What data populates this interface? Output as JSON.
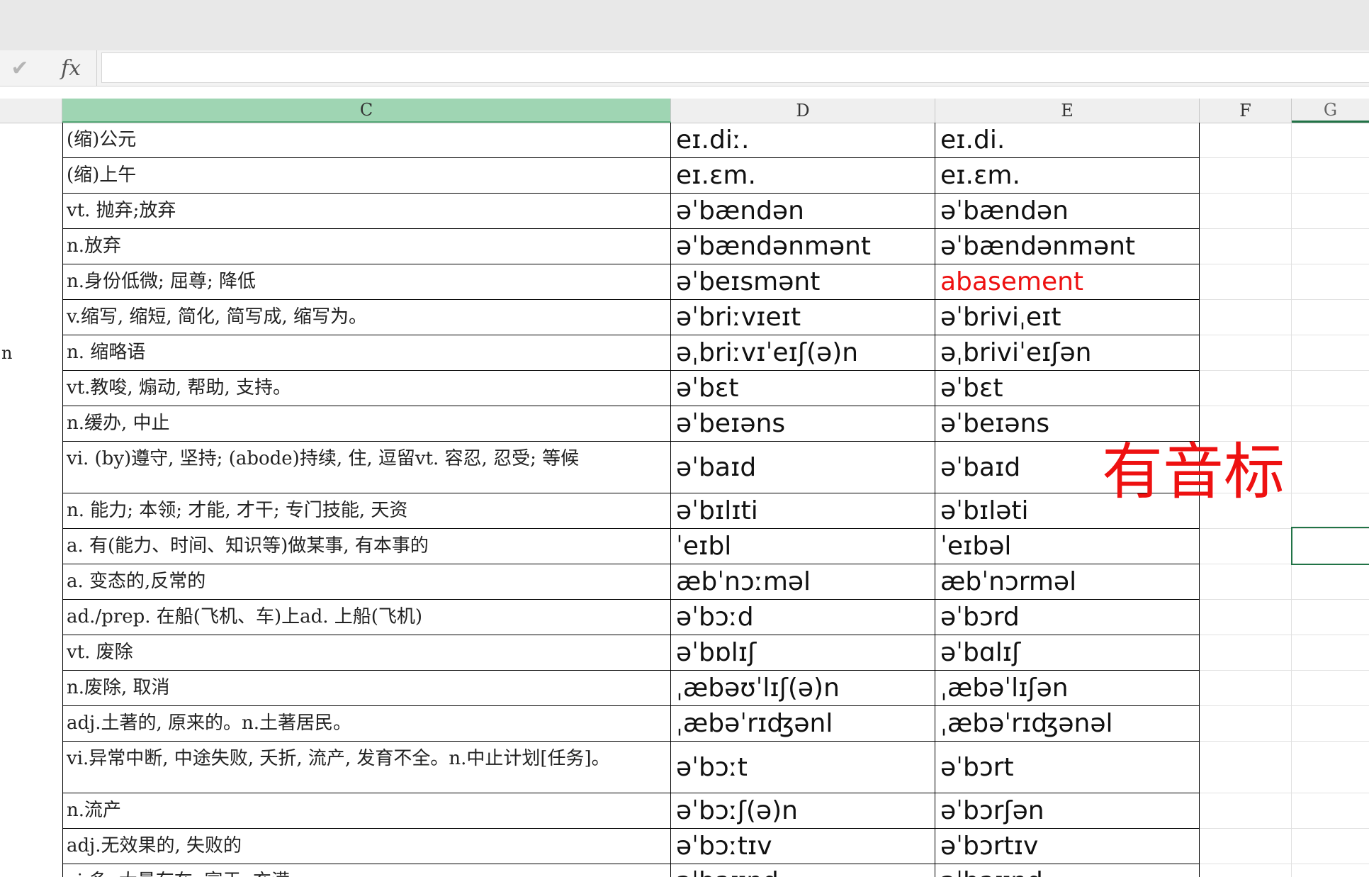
{
  "formula_bar": {
    "check_icon": "check-icon",
    "fx_label": "fx",
    "value": ""
  },
  "columns": {
    "C": "C",
    "D": "D",
    "E": "E",
    "F": "F",
    "G": "G"
  },
  "rows": [
    {
      "b": "",
      "c": "(缩)公元",
      "d": "eɪ.diː.",
      "e": "eɪ.di."
    },
    {
      "b": "",
      "c": "(缩)上午",
      "d": "eɪ.ɛm.",
      "e": "eɪ.ɛm."
    },
    {
      "b": "",
      "c": "vt. 抛弃;放弃",
      "d": "əˈbændən",
      "e": "əˈbændən"
    },
    {
      "b": "",
      "c": "n.放弃",
      "d": "əˈbændənmənt",
      "e": "əˈbændənmənt"
    },
    {
      "b": "",
      "c": "n.身份低微; 屈尊; 降低",
      "d": "əˈbeɪsmənt",
      "e": "abasement",
      "e_red": true
    },
    {
      "b": "",
      "c": "v.缩写, 缩短, 简化, 简写成, 缩写为。",
      "d": "əˈbriːvɪeɪt",
      "e": "əˈbriviˌeɪt"
    },
    {
      "b": "n",
      "c": "n. 缩略语",
      "d": "əˌbriːvɪˈeɪʃ(ə)n",
      "e": "əˌbriviˈeɪʃən"
    },
    {
      "b": "",
      "c": "vt.教唆, 煽动, 帮助, 支持。",
      "d": "əˈbɛt",
      "e": "əˈbɛt"
    },
    {
      "b": "",
      "c": "n.缓办, 中止",
      "d": "əˈbeɪəns",
      "e": "əˈbeɪəns"
    },
    {
      "b": "",
      "c": "vi. (by)遵守, 坚持; (abode)持续, 住, 逗留vt. 容忍, 忍受; 等候",
      "d": "əˈbaɪd",
      "e": "əˈbaɪd",
      "tall": true
    },
    {
      "b": "",
      "c": "n. 能力; 本领; 才能, 才干; 专门技能, 天资",
      "d": "əˈbɪlɪti",
      "e": "əˈbɪləti"
    },
    {
      "b": "",
      "c": "a. 有(能力、时间、知识等)做某事, 有本事的",
      "d": "ˈeɪbl",
      "e": "ˈeɪbəl"
    },
    {
      "b": "",
      "c": "a. 变态的,反常的",
      "d": "æbˈnɔːməl",
      "e": "æbˈnɔrməl"
    },
    {
      "b": "",
      "c": "ad./prep. 在船(飞机、车)上ad. 上船(飞机)",
      "d": "əˈbɔːd",
      "e": "əˈbɔrd"
    },
    {
      "b": "",
      "c": "vt. 废除",
      "d": "əˈbɒlɪʃ",
      "e": "əˈbɑlɪʃ"
    },
    {
      "b": "",
      "c": "n.废除, 取消",
      "d": "ˌæbəʊˈlɪʃ(ə)n",
      "e": "ˌæbəˈlɪʃən"
    },
    {
      "b": "",
      "c": "adj.土著的, 原来的。n.土著居民。",
      "d": "ˌæbəˈrɪʤənl",
      "e": "ˌæbəˈrɪʤənəl"
    },
    {
      "b": "",
      "c": "vi.异常中断, 中途失败, 夭折, 流产, 发育不全。n.中止计划[任务]。",
      "d": "əˈbɔːt",
      "e": "əˈbɔrt",
      "tall": true
    },
    {
      "b": "",
      "c": "n.流产",
      "d": "əˈbɔːʃ(ə)n",
      "e": "əˈbɔrʃən"
    },
    {
      "b": "",
      "c": "adj.无效果的, 失败的",
      "d": "əˈbɔːtɪv",
      "e": "əˈbɔrtɪv"
    },
    {
      "b": "",
      "c": "vi.多, 大量存在, 富于, 充满",
      "d": "əˈbaʊnd",
      "e": "əˈbaʊnd"
    }
  ],
  "annotation": "有音标"
}
